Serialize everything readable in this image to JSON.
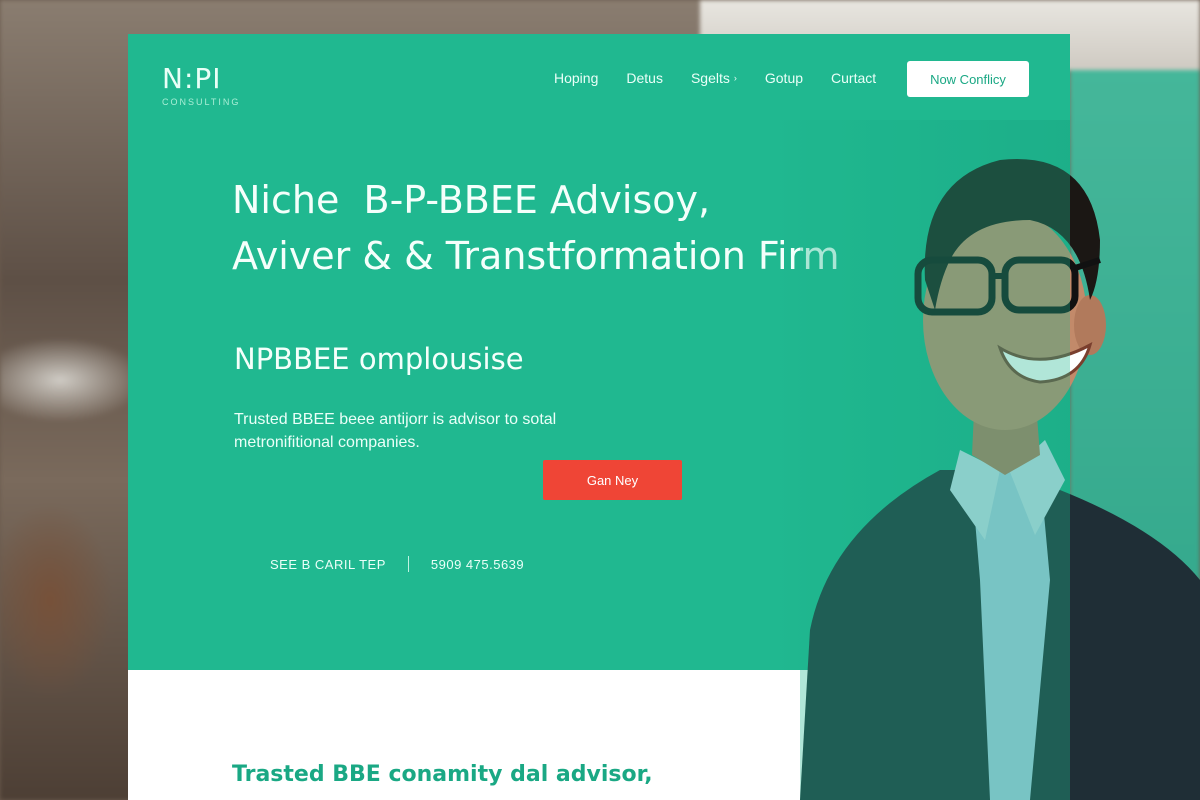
{
  "brand": {
    "logo": "N:PI",
    "tagline": "CONSULTING"
  },
  "nav": {
    "items": [
      {
        "label": "Hoping",
        "dropdown": false
      },
      {
        "label": "Detus",
        "dropdown": false
      },
      {
        "label": "Sgelts",
        "dropdown": true
      },
      {
        "label": "Gotup",
        "dropdown": false
      },
      {
        "label": "Curtact",
        "dropdown": false
      }
    ],
    "cta_label": "Now Conflicy"
  },
  "hero": {
    "headline_line1": "Niche  B-P-BBEE Advisoy,",
    "headline_line2": "Aviver & & Transtformation Firm",
    "subhead": "NPBBEE omplousise",
    "body": "Trusted BBEE beee antijorr is advisor to sotal metronifitional companies.",
    "cta_label": "Gan Ney",
    "contact_left": "SEE B CARIL TEP",
    "contact_right": "5909 475.5639"
  },
  "section": {
    "title": "Trasted BBE conamity dal advisor,"
  },
  "colors": {
    "brand_teal": "#20b890",
    "cta_red": "#ef4536",
    "heading_green": "#1aa884"
  }
}
